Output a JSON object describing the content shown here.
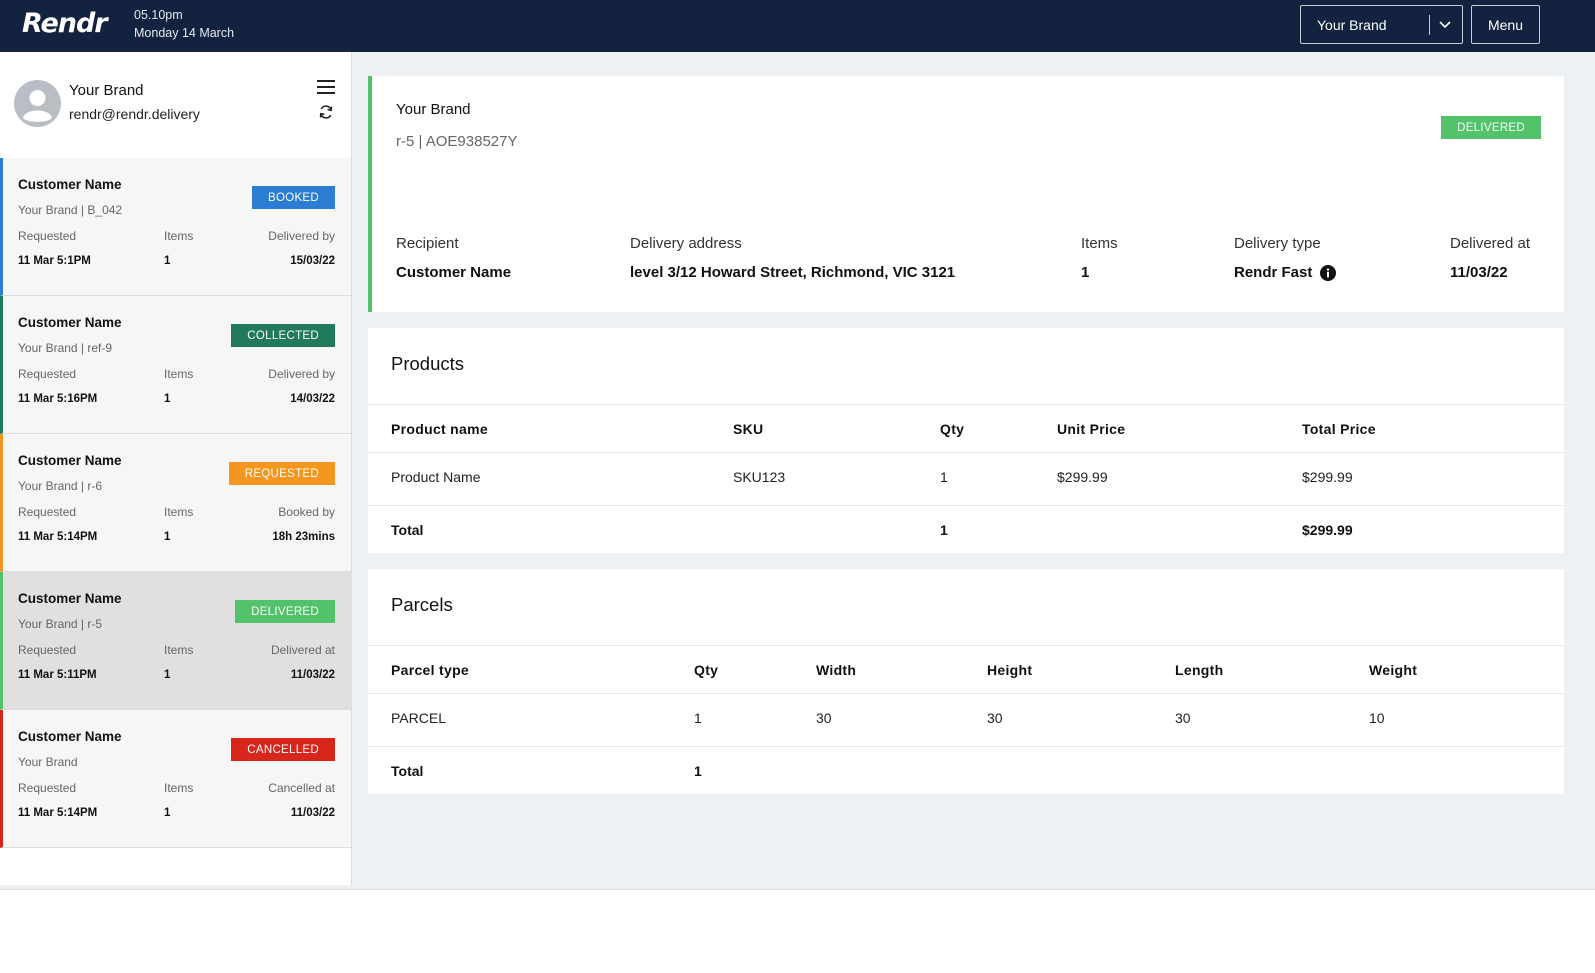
{
  "topbar": {
    "logo": "Rendr",
    "time": "05.10pm",
    "date": "Monday 14 March",
    "brand_select": "Your Brand",
    "menu_label": "Menu"
  },
  "profile": {
    "name": "Your Brand",
    "email": "rendr@rendr.delivery"
  },
  "orders": [
    {
      "name": "Customer Name",
      "ref": "Your Brand | B_042",
      "status": "BOOKED",
      "status_color": "#2a7dd1",
      "col1_label": "Requested",
      "col1_value": "11 Mar 5:1PM",
      "col2_label": "Items",
      "col2_value": "1",
      "col3_label": "Delivered by",
      "col3_value": "15/03/22"
    },
    {
      "name": "Customer Name",
      "ref": "Your Brand | ref-9",
      "status": "COLLECTED",
      "status_color": "#217a5c",
      "col1_label": "Requested",
      "col1_value": "11 Mar 5:16PM",
      "col2_label": "Items",
      "col2_value": "1",
      "col3_label": "Delivered by",
      "col3_value": "14/03/22"
    },
    {
      "name": "Customer Name",
      "ref": "Your Brand | r-6",
      "status": "REQUESTED",
      "status_color": "#f5961e",
      "col1_label": "Requested",
      "col1_value": "11 Mar 5:14PM",
      "col2_label": "Items",
      "col2_value": "1",
      "col3_label": "Booked by",
      "col3_value": "18h 23mins"
    },
    {
      "name": "Customer Name",
      "ref": "Your Brand | r-5",
      "status": "DELIVERED",
      "status_color": "#52c26b",
      "col1_label": "Requested",
      "col1_value": "11 Mar 5:11PM",
      "col2_label": "Items",
      "col2_value": "1",
      "col3_label": "Delivered at",
      "col3_value": "11/03/22"
    },
    {
      "name": "Customer Name",
      "ref": "Your Brand",
      "status": "CANCELLED",
      "status_color": "#d9261c",
      "col1_label": "Requested",
      "col1_value": "11 Mar 5:14PM",
      "col2_label": "Items",
      "col2_value": "1",
      "col3_label": "Cancelled at",
      "col3_value": "11/03/22"
    }
  ],
  "summary": {
    "brand": "Your Brand",
    "ref": "r-5 | AOE938527Y",
    "status": "DELIVERED",
    "recipient_label": "Recipient",
    "recipient": "Customer Name",
    "address_label": "Delivery address",
    "address": "level 3/12 Howard Street, Richmond, VIC 3121",
    "items_label": "Items",
    "items": "1",
    "type_label": "Delivery type",
    "type": "Rendr Fast",
    "delivered_label": "Delivered at",
    "delivered": "11/03/22"
  },
  "products": {
    "title": "Products",
    "headers": [
      "Product name",
      "SKU",
      "Qty",
      "Unit Price",
      "Total Price"
    ],
    "rows": [
      [
        "Product Name",
        "SKU123",
        "1",
        "$299.99",
        "$299.99"
      ]
    ],
    "total": [
      "Total",
      "",
      "1",
      "",
      "$299.99"
    ]
  },
  "parcels": {
    "title": "Parcels",
    "headers": [
      "Parcel type",
      "Qty",
      "Width",
      "Height",
      "Length",
      "Weight"
    ],
    "rows": [
      [
        "PARCEL",
        "1",
        "30",
        "30",
        "30",
        "10"
      ]
    ],
    "total": [
      "Total",
      "1",
      "",
      "",
      "",
      ""
    ]
  },
  "selected_order_index": 3
}
